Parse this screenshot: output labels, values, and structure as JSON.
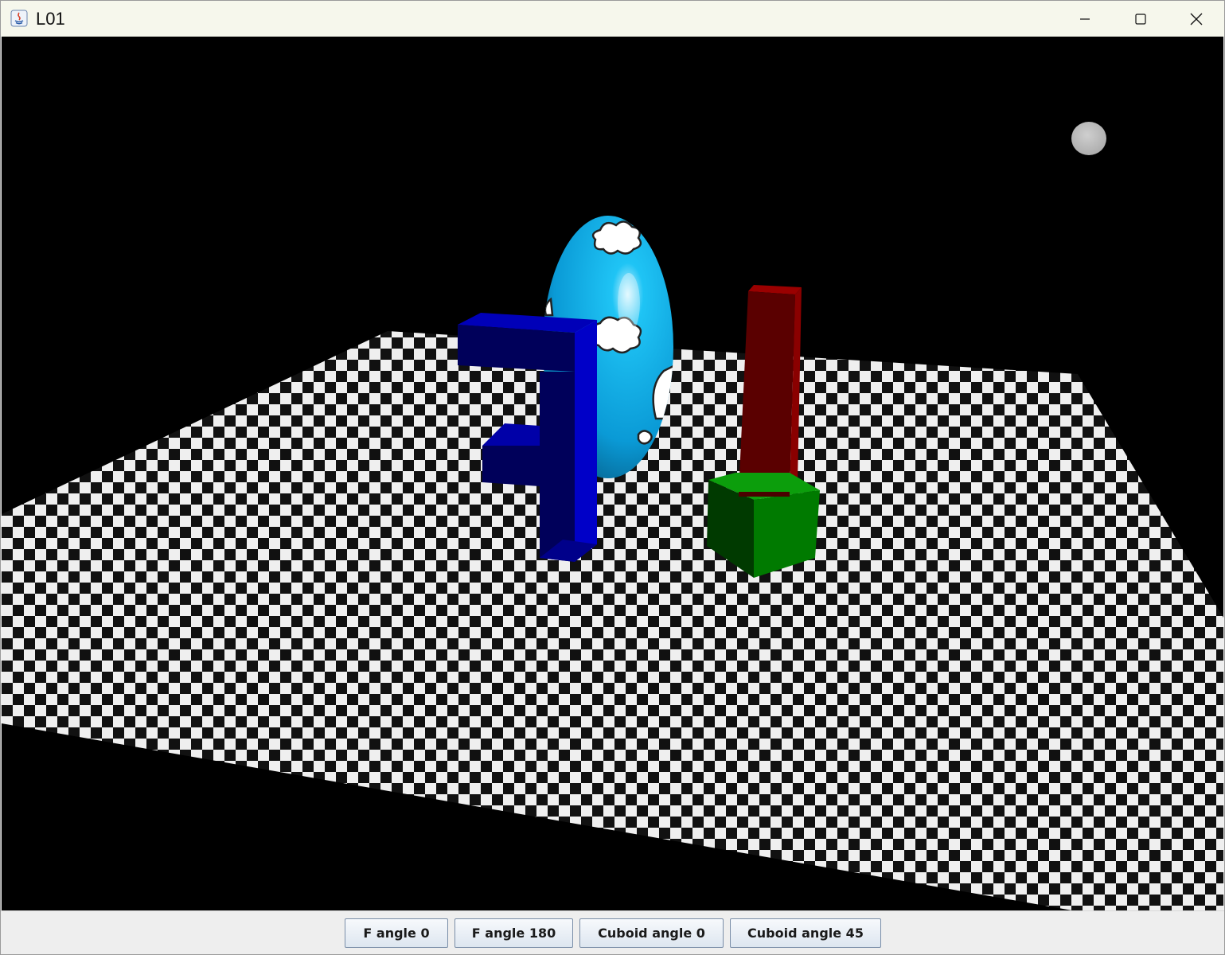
{
  "window": {
    "title": "L01",
    "icons": {
      "app": "java-app-icon",
      "minimize": "minimize-icon",
      "maximize": "maximize-icon",
      "close": "close-icon"
    }
  },
  "scene": {
    "background_color": "#000000",
    "objects": [
      "checkerboard-floor",
      "sky-egg",
      "blue-f-shape",
      "green-cube",
      "red-cuboid",
      "light-sphere"
    ],
    "colors": {
      "egg": "#1ab8ee",
      "f_shape": "#00007a",
      "cube": "#008a00",
      "cuboid": "#7a0000",
      "light": "#bdbdbd"
    }
  },
  "controls": {
    "buttons": [
      {
        "label": "F angle 0"
      },
      {
        "label": "F angle 180"
      },
      {
        "label": "Cuboid angle 0"
      },
      {
        "label": "Cuboid angle 45"
      }
    ]
  }
}
